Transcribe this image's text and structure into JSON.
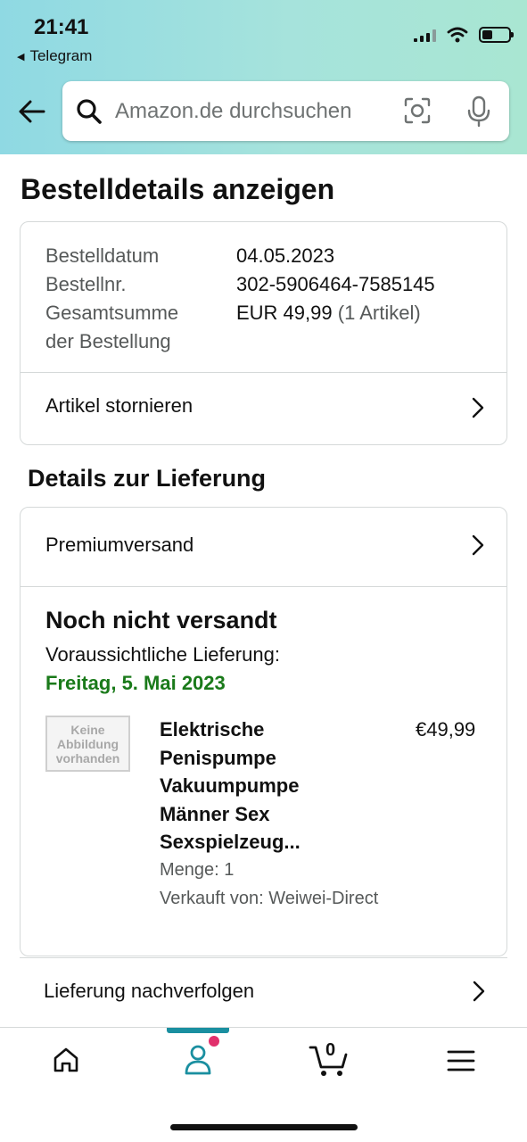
{
  "status_bar": {
    "time": "21:41",
    "back_app": "Telegram"
  },
  "search": {
    "placeholder": "Amazon.de durchsuchen"
  },
  "page": {
    "title": "Bestelldetails anzeigen"
  },
  "order_summary": {
    "rows": [
      {
        "label": "Bestelldatum",
        "value": "04.05.2023"
      },
      {
        "label": "Bestellnr.",
        "value": "302-5906464-7585145"
      }
    ],
    "total_label_line1": "Gesamtsumme",
    "total_label_line2": "der Bestellung",
    "total_value": "EUR 49,99",
    "total_items": "(1 Artikel)",
    "cancel_link": "Artikel stornieren"
  },
  "delivery": {
    "section_title": "Details zur Lieferung",
    "shipping_method": "Premiumversand",
    "status": "Noch nicht versandt",
    "eta_label": "Voraussichtliche Lieferung:",
    "eta_date": "Freitag, 5. Mai 2023",
    "track_link": "Lieferung nachverfolgen"
  },
  "product": {
    "no_image_text_1": "Keine",
    "no_image_text_2": "Abbildung",
    "no_image_text_3": "vorhanden",
    "name_lines": [
      "Elektrische",
      "Penispumpe",
      "Vakuumpumpe",
      "Männer Sex",
      "Sexspielzeug..."
    ],
    "price": "€49,99",
    "quantity": "Menge: 1",
    "seller": "Verkauft von: Weiwei-Direct"
  },
  "bottom_nav": {
    "items": [
      "home-icon",
      "account-icon",
      "cart-icon",
      "menu-icon"
    ],
    "cart_count": "0",
    "active_index": 1,
    "accent_color": "#1a8fa0",
    "notification_color": "#e1306c"
  },
  "colors": {
    "eta_green": "#1a7a1a",
    "muted_text": "#565959"
  }
}
